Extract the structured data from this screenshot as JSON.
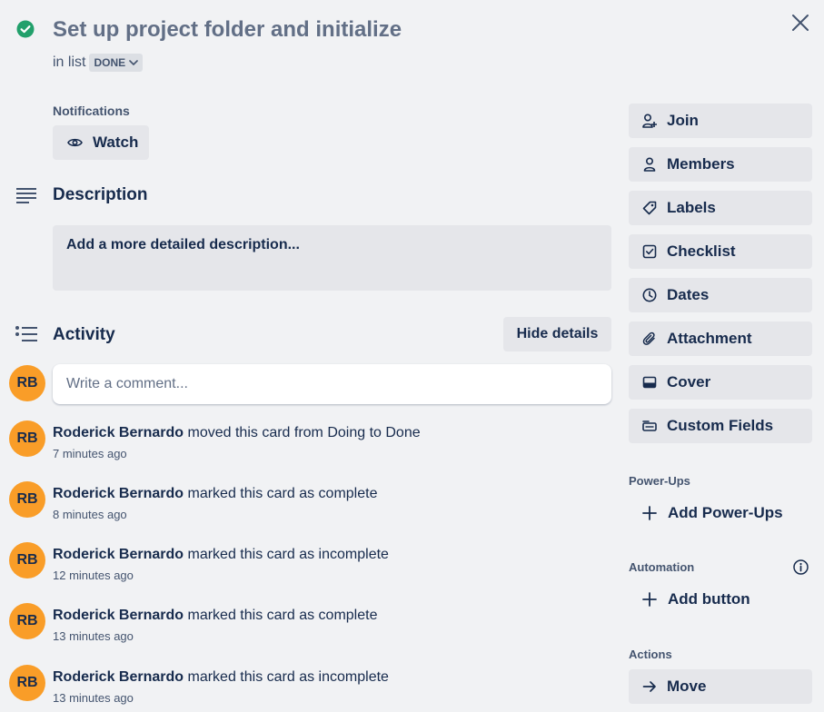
{
  "card": {
    "title": "Set up project folder and initialize",
    "in_list_prefix": "in list",
    "list_name": "DONE"
  },
  "notifications": {
    "label": "Notifications",
    "watch_label": "Watch"
  },
  "description": {
    "title": "Description",
    "placeholder": "Add a more detailed description..."
  },
  "activity": {
    "title": "Activity",
    "hide_details_label": "Hide details",
    "comment_placeholder": "Write a comment...",
    "current_user_initials": "RB",
    "entries": [
      {
        "initials": "RB",
        "user": "Roderick Bernardo",
        "action": "moved this card from Doing to Done",
        "time": "7 minutes ago"
      },
      {
        "initials": "RB",
        "user": "Roderick Bernardo",
        "action": "marked this card as complete",
        "time": "8 minutes ago"
      },
      {
        "initials": "RB",
        "user": "Roderick Bernardo",
        "action": "marked this card as incomplete",
        "time": "12 minutes ago"
      },
      {
        "initials": "RB",
        "user": "Roderick Bernardo",
        "action": "marked this card as complete",
        "time": "13 minutes ago"
      },
      {
        "initials": "RB",
        "user": "Roderick Bernardo",
        "action": "marked this card as incomplete",
        "time": "13 minutes ago"
      }
    ]
  },
  "sidebar": {
    "add_to_card": [
      {
        "label": "Join",
        "icon": "add-member-icon"
      },
      {
        "label": "Members",
        "icon": "member-icon"
      },
      {
        "label": "Labels",
        "icon": "label-icon"
      },
      {
        "label": "Checklist",
        "icon": "checklist-icon"
      },
      {
        "label": "Dates",
        "icon": "clock-icon"
      },
      {
        "label": "Attachment",
        "icon": "paperclip-icon"
      },
      {
        "label": "Cover",
        "icon": "cover-icon"
      },
      {
        "label": "Custom Fields",
        "icon": "custom-fields-icon"
      }
    ],
    "power_ups": {
      "label": "Power-Ups",
      "add_label": "Add Power-Ups"
    },
    "automation": {
      "label": "Automation",
      "add_label": "Add button"
    },
    "actions": {
      "label": "Actions",
      "move_label": "Move"
    }
  },
  "colors": {
    "background": "#f1f2f4",
    "button": "#e5e6ea",
    "avatar": "#f99d28",
    "complete_check": "#22a06b",
    "text": "#172b4d"
  }
}
